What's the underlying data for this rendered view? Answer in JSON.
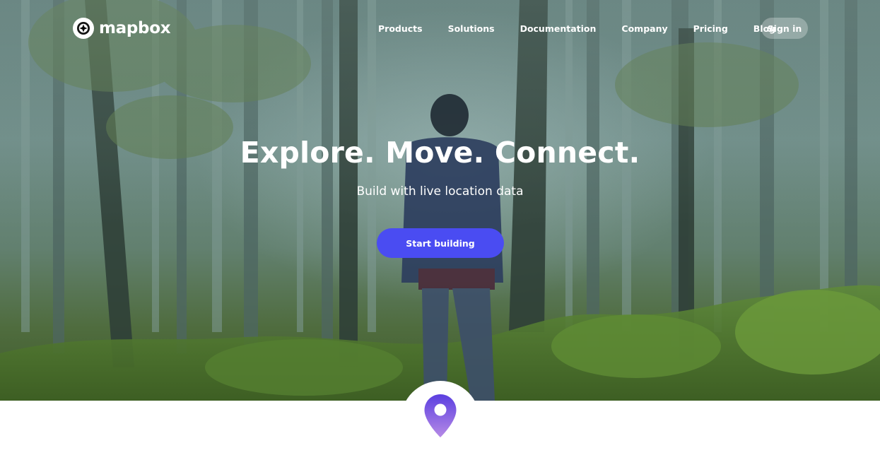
{
  "brand": {
    "name": "mapbox",
    "logo_icon": "mapbox-compass-icon"
  },
  "nav": {
    "items": [
      {
        "label": "Products"
      },
      {
        "label": "Solutions"
      },
      {
        "label": "Documentation"
      },
      {
        "label": "Company"
      },
      {
        "label": "Pricing"
      },
      {
        "label": "Blog"
      }
    ],
    "sign_in_label": "Sign in"
  },
  "hero": {
    "headline": "Explore. Move. Connect.",
    "subheadline": "Build with live location data",
    "cta_label": "Start building"
  },
  "feature_icon": "location-pin-icon",
  "colors": {
    "accent": "#4a4cf2",
    "pin_top": "#5b3fe0",
    "pin_bottom": "#b68ae6"
  }
}
